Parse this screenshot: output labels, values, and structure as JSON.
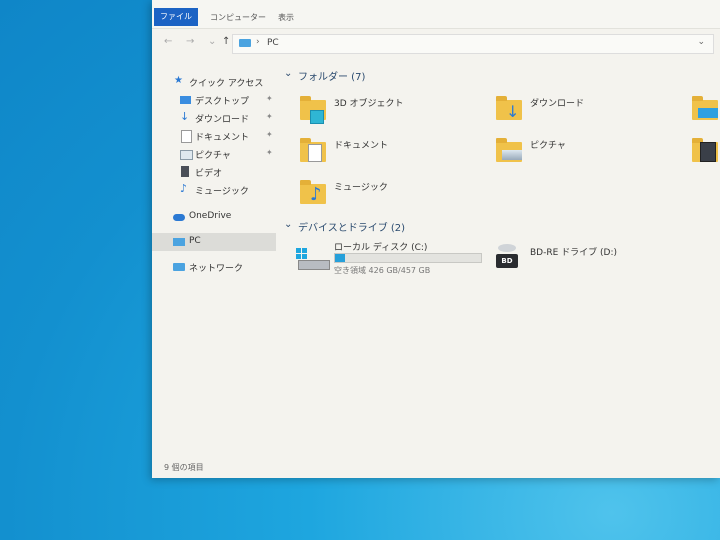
{
  "ribbon": {
    "tabs": [
      "ファイル",
      "コンピューター",
      "表示"
    ]
  },
  "address": {
    "back": "←",
    "forward": "→",
    "up": "↑",
    "separator": "›",
    "path": "PC",
    "dropdown": "⌄"
  },
  "sidebar": {
    "items": [
      {
        "label": "クイック アクセス",
        "icon": "star-icon"
      },
      {
        "label": "デスクトップ",
        "icon": "desktop-icon",
        "pinned": true
      },
      {
        "label": "ダウンロード",
        "icon": "download-icon",
        "pinned": true
      },
      {
        "label": "ドキュメント",
        "icon": "document-icon",
        "pinned": true
      },
      {
        "label": "ピクチャ",
        "icon": "picture-icon",
        "pinned": true
      },
      {
        "label": "ビデオ",
        "icon": "video-icon"
      },
      {
        "label": "ミュージック",
        "icon": "music-icon"
      },
      {
        "label": "OneDrive",
        "icon": "cloud-icon"
      },
      {
        "label": "PC",
        "icon": "pc-icon",
        "selected": true
      },
      {
        "label": "ネットワーク",
        "icon": "network-icon"
      }
    ],
    "pin_glyph": "✦"
  },
  "content": {
    "folders_header": "フォルダー (7)",
    "folders": [
      {
        "label": "3D オブジェクト",
        "icon": "3d-objects-folder-icon"
      },
      {
        "label": "ダウンロード",
        "icon": "downloads-folder-icon"
      },
      {
        "label": "ドキュメント",
        "icon": "documents-folder-icon"
      },
      {
        "label": "ピクチャ",
        "icon": "pictures-folder-icon"
      },
      {
        "label": "ミュージック",
        "icon": "music-folder-icon"
      }
    ],
    "drives_header": "デバイスとドライブ (2)",
    "drives": [
      {
        "label": "ローカル ディスク (C:)",
        "free_text": "空き領域 426 GB/457 GB",
        "used_fraction": 0.07,
        "icon": "windows-drive-icon"
      },
      {
        "label": "BD-RE ドライブ (D:)",
        "icon": "bd-drive-icon",
        "badge": "BD"
      }
    ],
    "chevron": "⌄"
  },
  "status": {
    "item_count": "9 個の項目"
  },
  "colors": {
    "accent": "#1c63c4",
    "folder": "#f0c24a",
    "drive_fill": "#26a0da"
  }
}
